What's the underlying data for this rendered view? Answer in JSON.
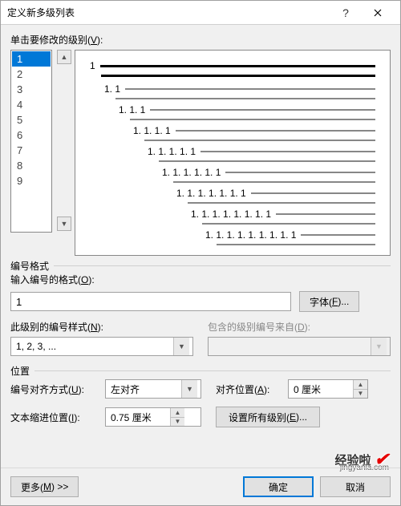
{
  "titlebar": {
    "title": "定义新多级列表"
  },
  "click_level_label_pre": "单击要修改的级别(",
  "click_level_label_u": "V",
  "click_level_label_post": "):",
  "levels": {
    "items": [
      "1",
      "2",
      "3",
      "4",
      "5",
      "6",
      "7",
      "8",
      "9"
    ],
    "selected": "1"
  },
  "preview": {
    "rows": [
      {
        "num": "1",
        "indent": 0,
        "dark": true
      },
      {
        "num": "1. 1",
        "indent": 18
      },
      {
        "num": "1. 1. 1",
        "indent": 36
      },
      {
        "num": "1. 1. 1. 1",
        "indent": 54
      },
      {
        "num": "1. 1. 1. 1. 1",
        "indent": 72
      },
      {
        "num": "1. 1. 1. 1. 1. 1",
        "indent": 90
      },
      {
        "num": "1. 1. 1. 1. 1. 1. 1",
        "indent": 108
      },
      {
        "num": "1. 1. 1. 1. 1. 1. 1. 1",
        "indent": 126
      },
      {
        "num": "1. 1. 1. 1. 1. 1. 1. 1. 1",
        "indent": 144
      }
    ]
  },
  "number_format": {
    "legend": "编号格式",
    "enter_format_label_pre": "输入编号的格式(",
    "enter_format_label_u": "O",
    "enter_format_label_post": "):",
    "value": "1",
    "font_btn_pre": "字体(",
    "font_btn_u": "F",
    "font_btn_post": ")...",
    "style_label_pre": "此级别的编号样式(",
    "style_label_u": "N",
    "style_label_post": "):",
    "style_value": "1, 2, 3, ...",
    "include_label_pre": "包含的级别编号来自(",
    "include_label_u": "D",
    "include_label_post": "):",
    "include_value": ""
  },
  "position": {
    "legend": "位置",
    "align_label_pre": "编号对齐方式(",
    "align_label_u": "U",
    "align_label_post": "):",
    "align_value": "左对齐",
    "align_at_label_pre": "对齐位置(",
    "align_at_label_u": "A",
    "align_at_label_post": "):",
    "align_at_value": "0 厘米",
    "indent_label_pre": "文本缩进位置(",
    "indent_label_u": "I",
    "indent_label_post": "):",
    "indent_value": "0.75 厘米",
    "set_all_pre": "设置所有级别(",
    "set_all_u": "E",
    "set_all_post": ")..."
  },
  "footer": {
    "more_pre": "更多(",
    "more_u": "M",
    "more_post": ") >>",
    "ok": "确定",
    "cancel": "取消"
  },
  "watermark": {
    "text": "经验啦",
    "sub": "jingyanla.com"
  }
}
